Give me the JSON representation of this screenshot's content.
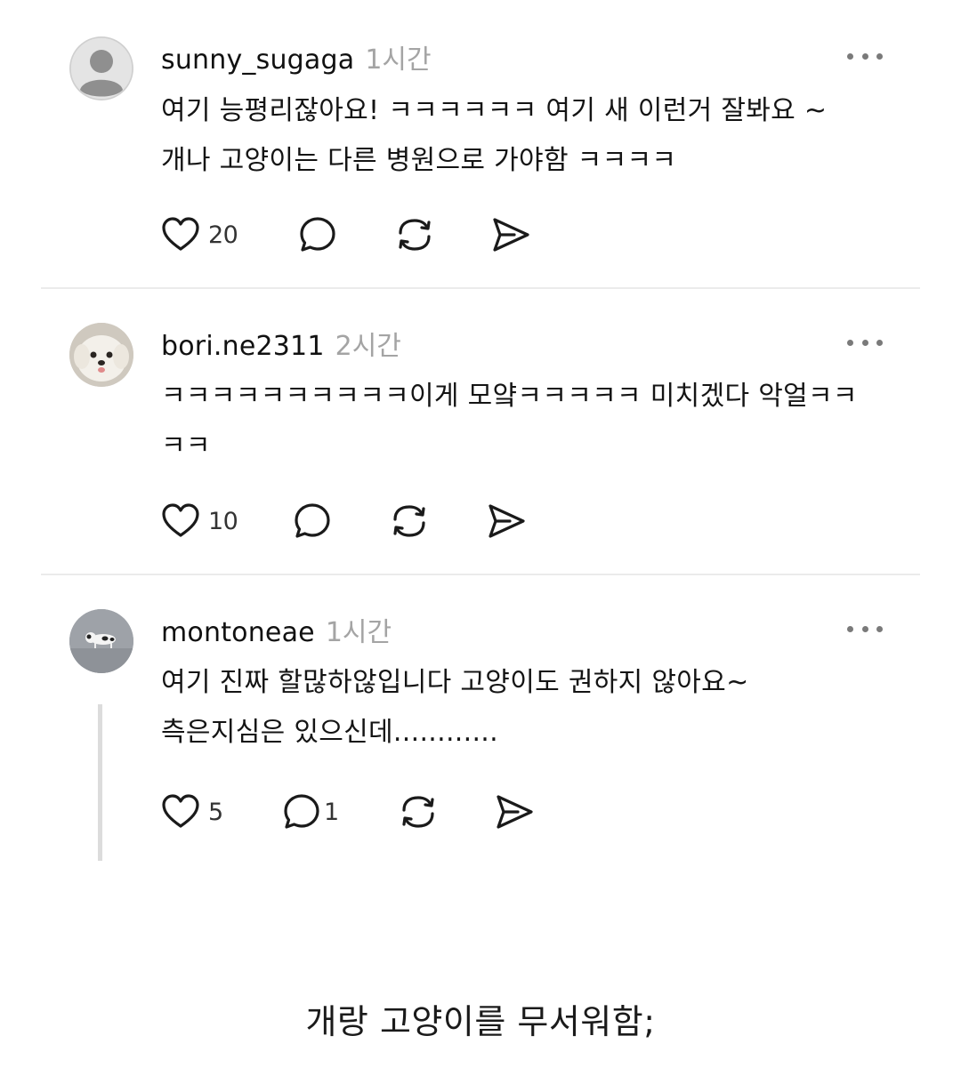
{
  "posts": [
    {
      "username": "sunny_sugaga",
      "time": "1시간",
      "text_line1": "여기 능평리잖아요! ㅋㅋㅋㅋㅋㅋ 여기 새 이런거 잘봐요 ~",
      "text_line2": "개나 고양이는 다른 병원으로 가야함 ㅋㅋㅋㅋ",
      "likes": "20",
      "replies": ""
    },
    {
      "username": "bori.ne2311",
      "time": "2시간",
      "text_line1": "ㅋㅋㅋㅋㅋㅋㅋㅋㅋㅋ이게 모얔ㅋㅋㅋㅋㅋ 미치겠다 악얼ㅋㅋ",
      "text_line2": "ㅋㅋ",
      "likes": "10",
      "replies": ""
    },
    {
      "username": "montoneae",
      "time": "1시간",
      "text_line1": "여기 진짜 할많하않입니다 고양이도 권하지 않아요~",
      "text_line2": "측은지심은 있으신데............",
      "likes": "5",
      "replies": "1"
    }
  ],
  "caption": "개랑 고양이를 무서워함;",
  "icons": {
    "like": "heart-outline-icon",
    "reply": "speech-bubble-icon",
    "repost": "repost-arrows-icon",
    "share": "paper-plane-icon",
    "more": "more-dots-icon"
  },
  "colors": {
    "text": "#141414",
    "muted": "#a4a4a4",
    "divider": "#ebebeb"
  }
}
